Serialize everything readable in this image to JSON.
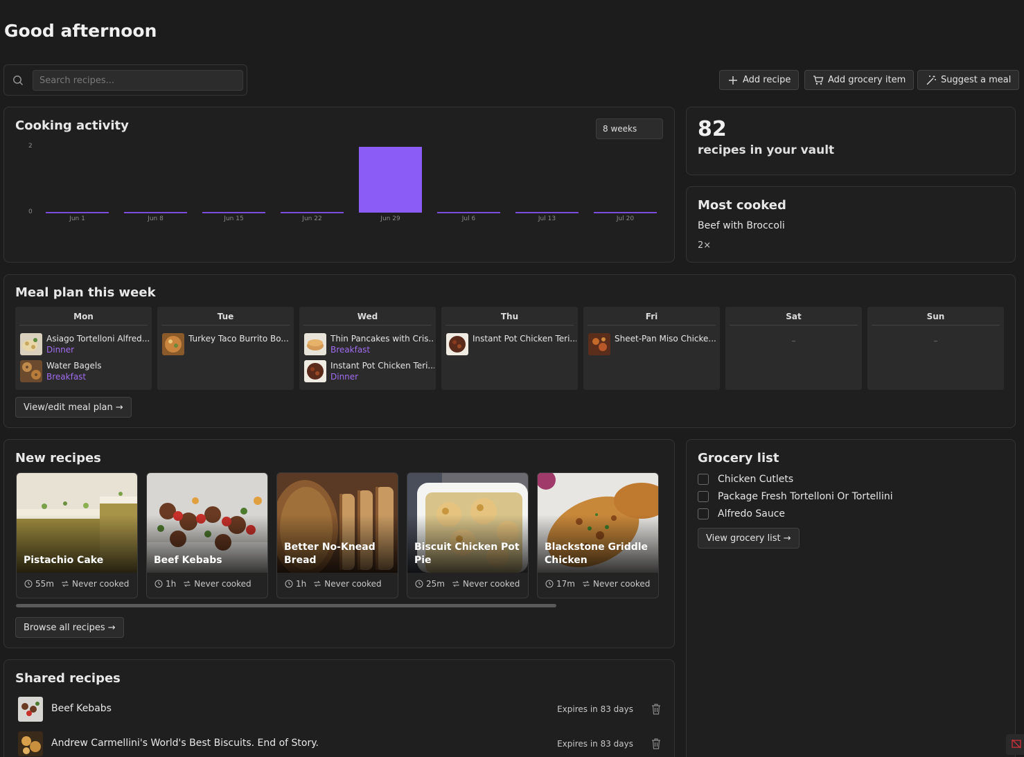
{
  "greeting": "Good afternoon",
  "search": {
    "placeholder": "Search recipes..."
  },
  "actions": {
    "add_recipe": "Add recipe",
    "add_grocery": "Add grocery item",
    "suggest_meal": "Suggest a meal"
  },
  "cooking_activity": {
    "title": "Cooking activity",
    "range_select": "8 weeks",
    "chart_data": {
      "type": "bar",
      "categories": [
        "Jun 1",
        "Jun 8",
        "Jun 15",
        "Jun 22",
        "Jun 29",
        "Jul 6",
        "Jul 13",
        "Jul 20"
      ],
      "values": [
        0,
        0,
        0,
        0,
        2,
        0,
        0,
        0
      ],
      "ylim": [
        0,
        2
      ],
      "yticks": [
        "2",
        "0"
      ],
      "color": "#8b5cf6",
      "grid": false
    }
  },
  "stats": {
    "count": "82",
    "count_label": "recipes in your vault"
  },
  "most_cooked": {
    "title": "Most cooked",
    "name": "Beef with Broccoli",
    "times": "2×"
  },
  "meal_plan": {
    "title": "Meal plan this week",
    "days": [
      {
        "name": "Mon",
        "meals": [
          {
            "name": "Asiago Tortelloni Alfred...",
            "type": "Dinner"
          },
          {
            "name": "Water Bagels",
            "type": "Breakfast"
          }
        ]
      },
      {
        "name": "Tue",
        "meals": [
          {
            "name": "Turkey Taco Burrito Bo...",
            "type": ""
          }
        ]
      },
      {
        "name": "Wed",
        "meals": [
          {
            "name": "Thin Pancakes with Cris...",
            "type": "Breakfast"
          },
          {
            "name": "Instant Pot Chicken Teri...",
            "type": "Dinner"
          }
        ]
      },
      {
        "name": "Thu",
        "meals": [
          {
            "name": "Instant Pot Chicken Teri...",
            "type": ""
          }
        ]
      },
      {
        "name": "Fri",
        "meals": [
          {
            "name": "Sheet-Pan Miso Chicke...",
            "type": ""
          }
        ]
      },
      {
        "name": "Sat",
        "empty": "–"
      },
      {
        "name": "Sun",
        "empty": "–"
      }
    ],
    "button": "View/edit meal plan →"
  },
  "new_recipes": {
    "title": "New recipes",
    "items": [
      {
        "title": "Pistachio Cake",
        "time": "55m",
        "cooked": "Never cooked"
      },
      {
        "title": "Beef Kebabs",
        "time": "1h",
        "cooked": "Never cooked"
      },
      {
        "title": "Better No-Knead Bread",
        "time": "1h",
        "cooked": "Never cooked"
      },
      {
        "title": "Biscuit Chicken Pot Pie",
        "time": "25m",
        "cooked": "Never cooked"
      },
      {
        "title": "Blackstone Griddle Chicken",
        "time": "17m",
        "cooked": "Never cooked"
      }
    ],
    "button": "Browse all recipes →"
  },
  "grocery": {
    "title": "Grocery list",
    "items": [
      "Chicken Cutlets",
      "Package Fresh Tortelloni Or Tortellini",
      "Alfredo Sauce"
    ],
    "button": "View grocery list →"
  },
  "shared": {
    "title": "Shared recipes",
    "items": [
      {
        "name": "Beef Kebabs",
        "expires": "Expires in 83 days"
      },
      {
        "name": "Andrew Carmellini's World's Best Biscuits. End of Story.",
        "expires": "Expires in 83 days"
      }
    ]
  }
}
